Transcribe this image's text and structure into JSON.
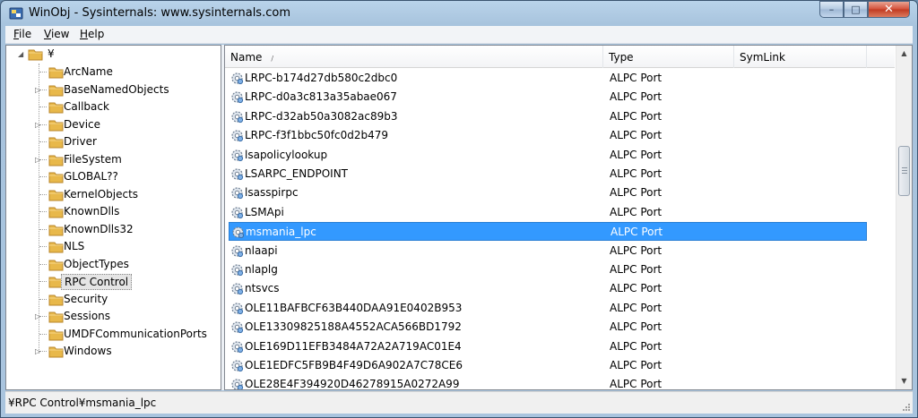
{
  "window": {
    "title": "WinObj - Sysinternals: www.sysinternals.com",
    "minimize_glyph": "–",
    "maximize_glyph": "□",
    "close_glyph": "✕"
  },
  "menu": [
    {
      "label": "File",
      "accel": "F",
      "rest": "ile"
    },
    {
      "label": "View",
      "accel": "V",
      "rest": "iew"
    },
    {
      "label": "Help",
      "accel": "H",
      "rest": "elp"
    }
  ],
  "tree": {
    "root_label": "¥",
    "root_expander": "◢",
    "items": [
      {
        "label": "ArcName",
        "expandable": false,
        "selected": false
      },
      {
        "label": "BaseNamedObjects",
        "expandable": true,
        "selected": false
      },
      {
        "label": "Callback",
        "expandable": false,
        "selected": false
      },
      {
        "label": "Device",
        "expandable": true,
        "selected": false
      },
      {
        "label": "Driver",
        "expandable": false,
        "selected": false
      },
      {
        "label": "FileSystem",
        "expandable": true,
        "selected": false
      },
      {
        "label": "GLOBAL??",
        "expandable": false,
        "selected": false
      },
      {
        "label": "KernelObjects",
        "expandable": false,
        "selected": false
      },
      {
        "label": "KnownDlls",
        "expandable": false,
        "selected": false
      },
      {
        "label": "KnownDlls32",
        "expandable": false,
        "selected": false
      },
      {
        "label": "NLS",
        "expandable": false,
        "selected": false
      },
      {
        "label": "ObjectTypes",
        "expandable": false,
        "selected": false
      },
      {
        "label": "RPC Control",
        "expandable": false,
        "selected": true
      },
      {
        "label": "Security",
        "expandable": false,
        "selected": false
      },
      {
        "label": "Sessions",
        "expandable": true,
        "selected": false
      },
      {
        "label": "UMDFCommunicationPorts",
        "expandable": false,
        "selected": false
      },
      {
        "label": "Windows",
        "expandable": true,
        "selected": false
      }
    ]
  },
  "list": {
    "columns": [
      "Name",
      "Type",
      "SymLink"
    ],
    "sort_indicator": "/",
    "rows": [
      {
        "name": "LRPC-b174d27db580c2dbc0",
        "type": "ALPC Port",
        "symlink": "",
        "selected": false
      },
      {
        "name": "LRPC-d0a3c813a35abae067",
        "type": "ALPC Port",
        "symlink": "",
        "selected": false
      },
      {
        "name": "LRPC-d32ab50a3082ac89b3",
        "type": "ALPC Port",
        "symlink": "",
        "selected": false
      },
      {
        "name": "LRPC-f3f1bbc50fc0d2b479",
        "type": "ALPC Port",
        "symlink": "",
        "selected": false
      },
      {
        "name": "lsapolicylookup",
        "type": "ALPC Port",
        "symlink": "",
        "selected": false
      },
      {
        "name": "LSARPC_ENDPOINT",
        "type": "ALPC Port",
        "symlink": "",
        "selected": false
      },
      {
        "name": "lsasspirpc",
        "type": "ALPC Port",
        "symlink": "",
        "selected": false
      },
      {
        "name": "LSMApi",
        "type": "ALPC Port",
        "symlink": "",
        "selected": false
      },
      {
        "name": "msmania_lpc",
        "type": "ALPC Port",
        "symlink": "",
        "selected": true
      },
      {
        "name": "nlaapi",
        "type": "ALPC Port",
        "symlink": "",
        "selected": false
      },
      {
        "name": "nlaplg",
        "type": "ALPC Port",
        "symlink": "",
        "selected": false
      },
      {
        "name": "ntsvcs",
        "type": "ALPC Port",
        "symlink": "",
        "selected": false
      },
      {
        "name": "OLE11BAFBCF63B440DAA91E0402B953",
        "type": "ALPC Port",
        "symlink": "",
        "selected": false
      },
      {
        "name": "OLE13309825188A4552ACA566BD1792",
        "type": "ALPC Port",
        "symlink": "",
        "selected": false
      },
      {
        "name": "OLE169D11EFB3484A72A2A719AC01E4",
        "type": "ALPC Port",
        "symlink": "",
        "selected": false
      },
      {
        "name": "OLE1EDFC5FB9B4F49D6A902A7C78CE6",
        "type": "ALPC Port",
        "symlink": "",
        "selected": false
      },
      {
        "name": "OLE28E4F394920D46278915A0272A99",
        "type": "ALPC Port",
        "symlink": "",
        "selected": false
      }
    ],
    "scroll_up_glyph": "▲",
    "scroll_down_glyph": "▼"
  },
  "status": {
    "path": "¥RPC Control¥msmania_lpc"
  },
  "colors": {
    "selection": "#3399ff",
    "folder": "#e8b84a",
    "titlebar": "#b9d3ea"
  }
}
